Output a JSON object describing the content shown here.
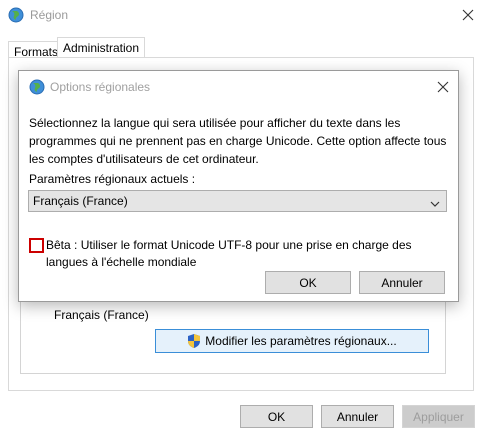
{
  "outer_window": {
    "title": "Région",
    "tabs": [
      {
        "label": "Formats"
      },
      {
        "label": "Administration",
        "active": true
      }
    ],
    "current_locale": "Français (France)",
    "modify_button_label": "Modifier les paramètres régionaux...",
    "buttons": {
      "ok": "OK",
      "cancel": "Annuler",
      "apply": "Appliquer"
    }
  },
  "dialog": {
    "title": "Options régionales",
    "description": "Sélectionnez la langue qui sera utilisée pour afficher du texte dans les programmes qui ne prennent pas en charge Unicode. Cette option affecte tous les comptes d'utilisateurs de cet ordinateur.",
    "current_label": "Paramètres régionaux actuels :",
    "select_value": "Français (France)",
    "beta_label": "Bêta : Utiliser le format Unicode UTF-8 pour une prise en charge des langues à l'échelle mondiale",
    "beta_checked": false,
    "buttons": {
      "ok": "OK",
      "cancel": "Annuler"
    }
  },
  "colors": {
    "highlight_border": "#cc0000",
    "accent_blue": "#3a8ed8",
    "button_face": "#e1e1e1"
  },
  "icons": [
    "globe-icon",
    "close-icon",
    "chevron-down-icon",
    "uac-shield-icon"
  ]
}
